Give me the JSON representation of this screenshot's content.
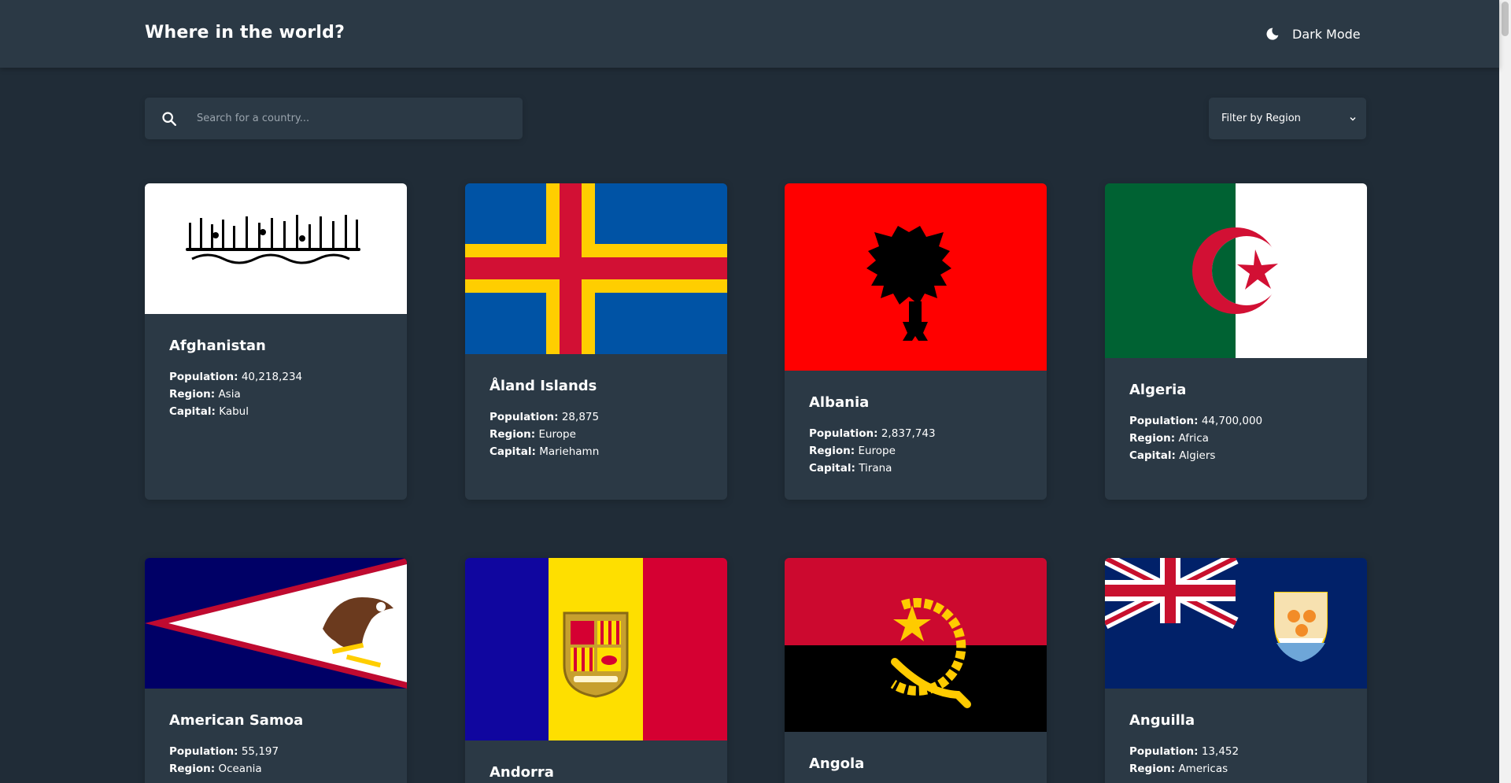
{
  "header": {
    "title": "Where in the world?",
    "theme_toggle_label": "Dark Mode",
    "theme_icon": "moon-icon"
  },
  "controls": {
    "search_placeholder": "Search for a country...",
    "search_value": "",
    "search_icon": "search-icon",
    "filter_selected": "Filter by Region",
    "filter_icon": "chevron-down-icon"
  },
  "labels": {
    "population": "Population:",
    "region": "Region:",
    "capital": "Capital:"
  },
  "countries": [
    {
      "name": "Afghanistan",
      "population": "40,218,234",
      "region": "Asia",
      "capital": "Kabul",
      "flag": "afghanistan-flag"
    },
    {
      "name": "Åland Islands",
      "population": "28,875",
      "region": "Europe",
      "capital": "Mariehamn",
      "flag": "aland-islands-flag"
    },
    {
      "name": "Albania",
      "population": "2,837,743",
      "region": "Europe",
      "capital": "Tirana",
      "flag": "albania-flag"
    },
    {
      "name": "Algeria",
      "population": "44,700,000",
      "region": "Africa",
      "capital": "Algiers",
      "flag": "algeria-flag"
    },
    {
      "name": "American Samoa",
      "population": "55,197",
      "region": "Oceania",
      "capital": "",
      "flag": "american-samoa-flag"
    },
    {
      "name": "Andorra",
      "population": "",
      "region": "",
      "capital": "",
      "flag": "andorra-flag"
    },
    {
      "name": "Angola",
      "population": "",
      "region": "",
      "capital": "",
      "flag": "angola-flag"
    },
    {
      "name": "Anguilla",
      "population": "13,452",
      "region": "Americas",
      "capital": "",
      "flag": "anguilla-flag"
    }
  ],
  "colors": {
    "background": "#202c37",
    "element": "#2b3945",
    "text": "#ffffff"
  }
}
